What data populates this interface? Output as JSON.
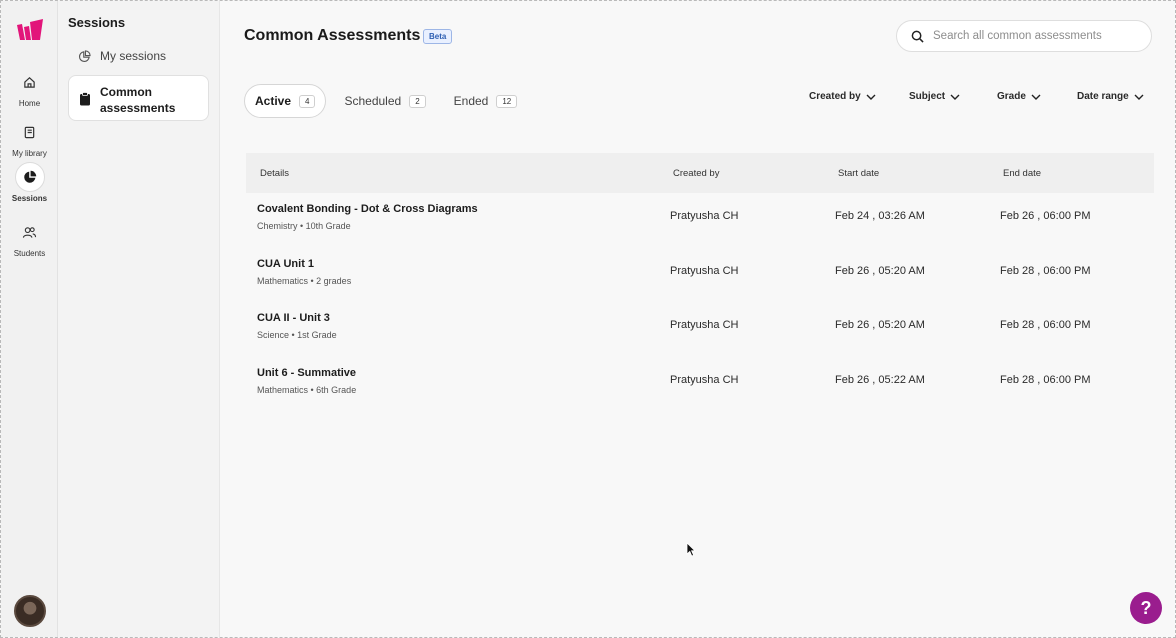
{
  "app": {
    "accent_color": "#e2157a",
    "help_color": "#9a1d8e",
    "help_label": "?"
  },
  "rail": {
    "items": [
      {
        "label": "Home",
        "icon": "home-icon"
      },
      {
        "label": "My library",
        "icon": "book-icon"
      },
      {
        "label": "Sessions",
        "icon": "pie-chart-icon",
        "active": true
      },
      {
        "label": "Students",
        "icon": "users-icon"
      }
    ]
  },
  "sidebar": {
    "title": "Sessions",
    "items": [
      {
        "label": "My sessions",
        "icon": "pie-chart-outline-icon"
      },
      {
        "label": "Common assessments",
        "icon": "clipboard-icon",
        "active": true
      }
    ]
  },
  "header": {
    "title": "Common Assessments",
    "badge": "Beta",
    "search_placeholder": "Search all common assessments"
  },
  "tabs": [
    {
      "label": "Active",
      "count": "4",
      "active": true
    },
    {
      "label": "Scheduled",
      "count": "2"
    },
    {
      "label": "Ended",
      "count": "12"
    }
  ],
  "filters": [
    {
      "label": "Created by"
    },
    {
      "label": "Subject"
    },
    {
      "label": "Grade"
    },
    {
      "label": "Date range"
    }
  ],
  "table": {
    "columns": [
      "Details",
      "Created by",
      "Start date",
      "End date"
    ],
    "rows": [
      {
        "title": "Covalent Bonding - Dot & Cross Diagrams",
        "subtitle": "Chemistry • 10th Grade",
        "created_by": "Pratyusha CH",
        "start": "Feb 24 , 03:26 AM",
        "end": "Feb 26 , 06:00 PM"
      },
      {
        "title": "CUA Unit 1",
        "subtitle": "Mathematics • 2 grades",
        "created_by": "Pratyusha CH",
        "start": "Feb 26 , 05:20 AM",
        "end": "Feb 28 , 06:00 PM"
      },
      {
        "title": "CUA II - Unit 3",
        "subtitle": "Science • 1st Grade",
        "created_by": "Pratyusha CH",
        "start": "Feb 26 , 05:20 AM",
        "end": "Feb 28 , 06:00 PM"
      },
      {
        "title": "Unit 6 - Summative",
        "subtitle": "Mathematics • 6th Grade",
        "created_by": "Pratyusha CH",
        "start": "Feb 26 , 05:22 AM",
        "end": "Feb 28 , 06:00 PM"
      }
    ]
  }
}
